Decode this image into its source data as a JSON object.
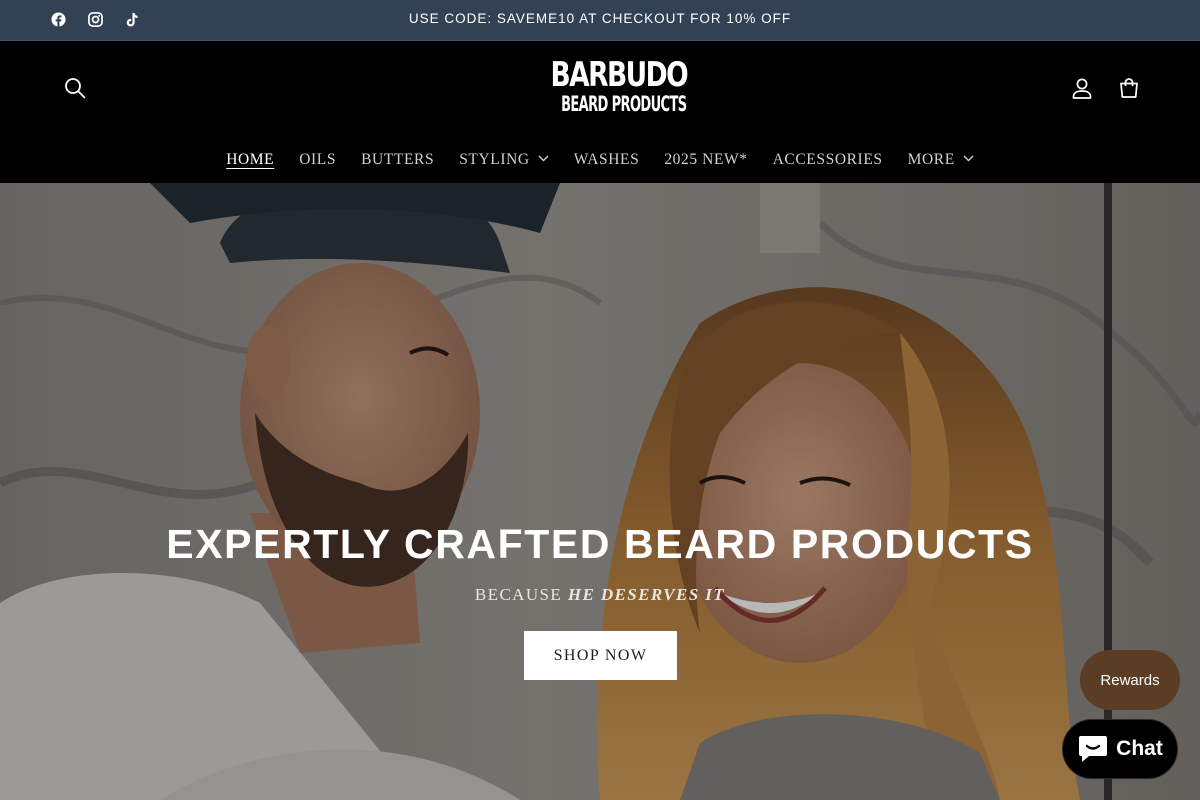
{
  "announcement": {
    "text": "USE CODE: SAVEME10 AT CHECKOUT FOR 10% OFF",
    "socials": [
      "facebook-icon",
      "instagram-icon",
      "tiktok-icon"
    ]
  },
  "header": {
    "logo_line1": "BARBUDO",
    "logo_line2": "BEARD PRODUCTS",
    "icons": [
      "search-icon",
      "account-icon",
      "cart-icon"
    ]
  },
  "nav": {
    "items": [
      {
        "label": "HOME",
        "active": true
      },
      {
        "label": "OILS"
      },
      {
        "label": "BUTTERS"
      },
      {
        "label": "STYLING",
        "dropdown": true
      },
      {
        "label": "WASHES"
      },
      {
        "label": "2025 NEW*"
      },
      {
        "label": "ACCESSORIES"
      },
      {
        "label": "MORE",
        "dropdown": true
      }
    ]
  },
  "hero": {
    "title": "EXPERTLY CRAFTED BEARD PRODUCTS",
    "subtitle_plain": "BECAUSE ",
    "subtitle_emphasis": "HE DESERVES IT",
    "cta": "SHOP NOW"
  },
  "widgets": {
    "rewards": "Rewards",
    "chat": "Chat"
  },
  "colors": {
    "announcement_bg": "#334155",
    "header_bg": "#000000",
    "rewards_bg": "#5b3d26",
    "chat_bg": "#000000"
  }
}
